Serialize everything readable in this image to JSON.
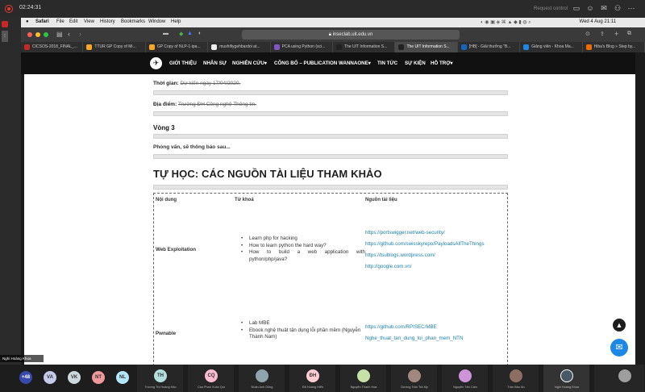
{
  "topbar": {
    "timer": "02:24:31",
    "request_control": "Request control"
  },
  "mac_menu": {
    "apple": "",
    "items": [
      "Safari",
      "File",
      "Edit",
      "View",
      "History",
      "Bookmarks",
      "Window",
      "Help"
    ],
    "clock": "Wed 4 Aug  21:11"
  },
  "safari": {
    "url": "inseclab.uit.edu.vn",
    "tabs": [
      "CICSOS-2018_FINAL_...",
      "TTUR GP Copy of Mi...",
      "GP Copy of NLP-1-ipa...",
      "mushifiygehbardoi at...",
      "PCA using Python (sci...",
      "The UIT Information S...",
      "The UIT Information S...",
      "[HB] - Giải thưởng \"B...",
      "Giảng viên - Khoa Ma...",
      "Hiba's Blog » Step by..."
    ],
    "active_tab_index": 6
  },
  "site": {
    "nav": [
      "GIỚI THIỆU",
      "NHÂN SỰ",
      "NGHIÊN CỨU",
      "CÔNG BỐ – PUBLICATION",
      "WANNAONE",
      "TIN TỨC",
      "SỰ KIỆN",
      "HỖ TRỢ"
    ],
    "time_label": "Thời gian:",
    "time_value": "Dự kiến ngày 17/04/2020.",
    "place_label": "Địa điểm:",
    "place_value": "Trường ĐH Công nghệ Thông tin.",
    "round": "Vòng 3",
    "interview": "Phỏng vấn, sẽ thông báo sau...",
    "section_title": "TỰ HỌC: CÁC NGUỒN TÀI LIỆU THAM KHẢO",
    "table": {
      "headers": [
        "Nội dung",
        "Từ khoá",
        "Nguồn tài liệu"
      ],
      "rows": [
        {
          "topic": "Web Exploitation",
          "keywords": [
            "Learn php for hacking",
            "How to learn python the hard way?",
            "How to build a web application with python/php/java?"
          ],
          "sources": [
            "https://portswigger.net/web-security/",
            "https://github.com/swisskyrepo/PayloadsAllTheThings",
            "https://tsublogs.wordpress.com/",
            "http://google.com.vn/"
          ]
        },
        {
          "topic": "Pwnable",
          "keywords": [
            "Lab MBE",
            "Ebook nghệ thuật tận dụng lỗi phần mềm (Nguyễn Thành Nam)"
          ],
          "sources": [
            "https://github.com/RPISEC/MBE",
            "Nghe_thuat_tan_dung_loi_phan_mem_NTN"
          ]
        }
      ]
    }
  },
  "speaker_label": "Nghi Hoàng Khoa",
  "participants_small": [
    {
      "initials": "+48",
      "color": "#3949ab"
    },
    {
      "initials": "VA",
      "color": "#c5cae9"
    },
    {
      "initials": "VK",
      "color": "#cfd8dc"
    },
    {
      "initials": "NT",
      "color": "#ef9a9a"
    },
    {
      "initials": "NL",
      "color": "#b3e5fc"
    }
  ],
  "participant_tiles": [
    {
      "initials": "TH",
      "name": "Trương Thị Hoàng Hảo",
      "color": "#b2dfdb"
    },
    {
      "initials": "CQ",
      "name": "Cao Phan Xuân Quí",
      "color": "#f8bbd0"
    },
    {
      "initials": "",
      "name": "Đoàn Anh Dũng",
      "color": "#90a4ae"
    },
    {
      "initials": "ĐH",
      "name": "Đỗ Hoàng Hiển",
      "color": "#ffcdd2"
    },
    {
      "initials": "",
      "name": "Nguyễn Thanh Hòa",
      "color": "#c5e1a5"
    },
    {
      "initials": "",
      "name": "Dương Trần Trà My",
      "color": "#a1887f"
    },
    {
      "initials": "",
      "name": "Nguyễn Tấn Cầm",
      "color": "#ce93d8"
    },
    {
      "initials": "",
      "name": "Trần Bảo Ân",
      "color": "#8d6e63"
    },
    {
      "initials": "",
      "name": "Nghi Hoàng Khoa",
      "color": "#455a64"
    },
    {
      "initials": "",
      "name": "",
      "color": "#9e9e9e"
    }
  ]
}
